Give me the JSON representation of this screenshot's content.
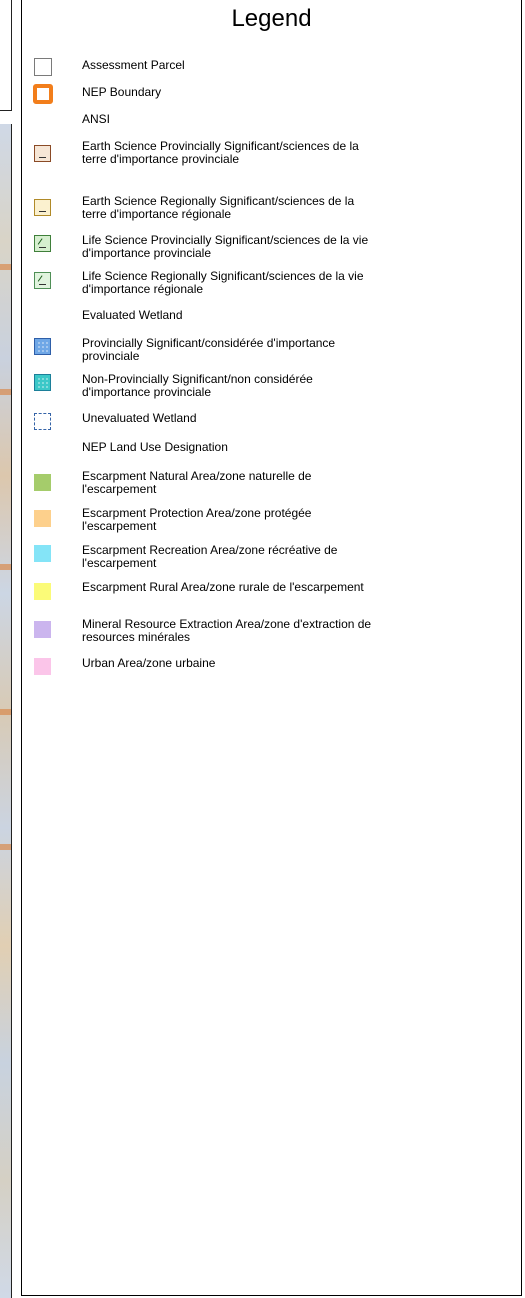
{
  "legend": {
    "title": "Legend",
    "items": [
      {
        "type": "symbol",
        "symbol": "assessment-parcel",
        "label": "Assessment Parcel",
        "color": "#7a7a7a"
      },
      {
        "type": "symbol",
        "symbol": "nep-boundary",
        "label": "NEP Boundary",
        "color": "#f27e1b"
      },
      {
        "type": "heading",
        "label": "ANSI"
      },
      {
        "type": "symbol",
        "symbol": "earth-science-provincial",
        "label": "Earth Science Provincially Significant/sciences de la terre d'importance provinciale",
        "color": "#8a4a26"
      },
      {
        "type": "symbol",
        "symbol": "earth-science-regional",
        "label": "Earth Science Regionally Significant/sciences de la terre d'importance régionale",
        "color": "#b08a28"
      },
      {
        "type": "symbol",
        "symbol": "life-science-provincial",
        "label": "Life Science Provincially Significant/sciences de la vie d'importance provinciale",
        "color": "#3f7f3a"
      },
      {
        "type": "symbol",
        "symbol": "life-science-regional",
        "label": "Life Science Regionally Significant/sciences de la vie d'importance régionale",
        "color": "#4f8f56"
      },
      {
        "type": "heading",
        "label": "Evaluated Wetland"
      },
      {
        "type": "symbol",
        "symbol": "wetland-provincial",
        "label": "Provincially Significant/considérée d'importance provinciale",
        "color": "#6fa7e6"
      },
      {
        "type": "symbol",
        "symbol": "wetland-non-provincial",
        "label": "Non-Provincially Significant/non considérée d'importance provinciale",
        "color": "#3cc8c8"
      },
      {
        "type": "symbol",
        "symbol": "wetland-unevaluated",
        "label": "Unevaluated Wetland",
        "color": "#3463a7"
      },
      {
        "type": "heading",
        "label": "NEP Land Use Designation"
      },
      {
        "type": "fill",
        "symbol": "escarpment-natural",
        "label": "Escarpment Natural Area/zone naturelle de l'escarpement",
        "color": "#a5cc6b"
      },
      {
        "type": "fill",
        "symbol": "escarpment-protection",
        "label": "Escarpment Protection Area/zone protégée l'escarpement",
        "color": "#fdd08c"
      },
      {
        "type": "fill",
        "symbol": "escarpment-recreation",
        "label": "Escarpment Recreation Area/zone récréative de l'escarpement",
        "color": "#84e4f7"
      },
      {
        "type": "fill",
        "symbol": "escarpment-rural",
        "label": "Escarpment Rural Area/zone rurale de l'escarpement",
        "color": "#fbfb78"
      },
      {
        "type": "fill",
        "symbol": "mineral-resource",
        "label": "Mineral Resource Extraction Area/zone d'extraction de resources minérales",
        "color": "#cbb5ee"
      },
      {
        "type": "fill",
        "symbol": "urban-area",
        "label": "Urban Area/zone urbaine",
        "color": "#fbc5e9"
      }
    ]
  }
}
